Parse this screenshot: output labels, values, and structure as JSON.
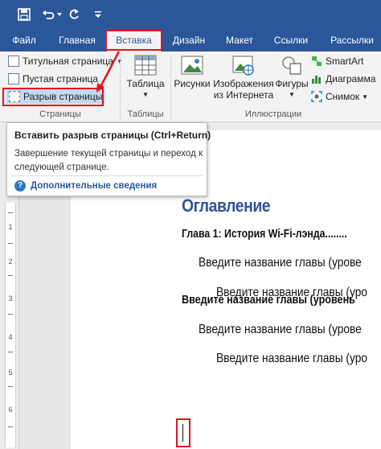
{
  "qat": {
    "icons": [
      "save-icon",
      "undo-icon",
      "dropdown-icon",
      "redo-icon",
      "customize-icon"
    ]
  },
  "tabs": [
    {
      "label": "Файл"
    },
    {
      "label": "Главная"
    },
    {
      "label": "Вставка",
      "active": true
    },
    {
      "label": "Дизайн"
    },
    {
      "label": "Макет"
    },
    {
      "label": "Ссылки"
    },
    {
      "label": "Рассылки"
    }
  ],
  "ribbon": {
    "pages_group": {
      "cover_page": "Титульная страница",
      "blank_page": "Пустая страница",
      "page_break": "Разрыв страницы",
      "label": "Страницы"
    },
    "tables_group": {
      "table": "Таблица",
      "label": "Таблицы"
    },
    "illustrations_group": {
      "pictures": "Рисунки",
      "online_pictures_line1": "Изображения",
      "online_pictures_line2": "из Интернета",
      "shapes": "Фигуры",
      "smartart": "SmartArt",
      "chart": "Диаграмма",
      "screenshot": "Снимок",
      "label": "Иллюстрации"
    }
  },
  "tooltip": {
    "title": "Вставить разрыв страницы (Ctrl+Return)",
    "description": "Завершение текущей страницы и переход к следующей странице.",
    "more_info": "Дополнительные сведения"
  },
  "ruler": {
    "numbers": [
      "1",
      "2",
      "3",
      "4",
      "5",
      "6"
    ]
  },
  "document": {
    "heading": "Оглавление",
    "entries": [
      {
        "level": 1,
        "text": "Глава 1: История Wi-Fi-лэнда........"
      },
      {
        "level": 2,
        "text": "Введите название главы (урове"
      },
      {
        "level": 3,
        "text": "Введите название главы (уро"
      },
      {
        "level": 1,
        "text": "Введите название главы (уровень"
      },
      {
        "level": 2,
        "text": "Введите название главы (урове"
      },
      {
        "level": 3,
        "text": "Введите название главы (уро"
      }
    ]
  },
  "colors": {
    "title_bar": "#2b579a",
    "highlight": "#e0151c",
    "heading": "#2e5597"
  }
}
